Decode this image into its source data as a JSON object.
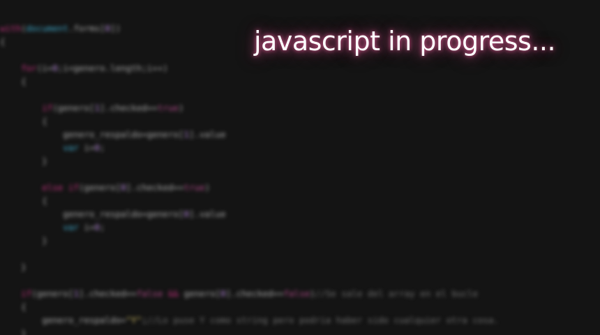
{
  "title": "javascript in progress...",
  "code_lines": [
    [
      {
        "t": "kw",
        "v": "with"
      },
      {
        "t": "txt",
        "v": "("
      },
      {
        "t": "obj",
        "v": "document"
      },
      {
        "t": "txt",
        "v": ".forms["
      },
      {
        "t": "num",
        "v": "0"
      },
      {
        "t": "txt",
        "v": "])"
      }
    ],
    [
      {
        "t": "txt",
        "v": "{"
      }
    ],
    [],
    [
      {
        "t": "txt",
        "v": "    "
      },
      {
        "t": "kw",
        "v": "for"
      },
      {
        "t": "txt",
        "v": "(i="
      },
      {
        "t": "num",
        "v": "0"
      },
      {
        "t": "txt",
        "v": ";i<genero.length;i++)"
      }
    ],
    [
      {
        "t": "txt",
        "v": "    {"
      }
    ],
    [],
    [
      {
        "t": "txt",
        "v": "        "
      },
      {
        "t": "kw",
        "v": "if"
      },
      {
        "t": "txt",
        "v": "(genero["
      },
      {
        "t": "num",
        "v": "1"
      },
      {
        "t": "txt",
        "v": "].checked=="
      },
      {
        "t": "lit",
        "v": "true"
      },
      {
        "t": "txt",
        "v": ")"
      }
    ],
    [
      {
        "t": "txt",
        "v": "        {"
      }
    ],
    [
      {
        "t": "txt",
        "v": "            genero_respaldo=genero["
      },
      {
        "t": "num",
        "v": "1"
      },
      {
        "t": "txt",
        "v": "].value"
      }
    ],
    [
      {
        "t": "txt",
        "v": "            "
      },
      {
        "t": "obj",
        "v": "var"
      },
      {
        "t": "txt",
        "v": " i="
      },
      {
        "t": "num",
        "v": "0"
      },
      {
        "t": "txt",
        "v": ";"
      }
    ],
    [
      {
        "t": "txt",
        "v": "        }"
      }
    ],
    [],
    [
      {
        "t": "txt",
        "v": "        "
      },
      {
        "t": "kw",
        "v": "else if"
      },
      {
        "t": "txt",
        "v": "(genero["
      },
      {
        "t": "num",
        "v": "0"
      },
      {
        "t": "txt",
        "v": "].checked=="
      },
      {
        "t": "lit",
        "v": "true"
      },
      {
        "t": "txt",
        "v": ")"
      }
    ],
    [
      {
        "t": "txt",
        "v": "        {"
      }
    ],
    [
      {
        "t": "txt",
        "v": "            genero_respaldo=genero["
      },
      {
        "t": "num",
        "v": "0"
      },
      {
        "t": "txt",
        "v": "].value"
      }
    ],
    [
      {
        "t": "txt",
        "v": "            "
      },
      {
        "t": "obj",
        "v": "var"
      },
      {
        "t": "txt",
        "v": " i="
      },
      {
        "t": "num",
        "v": "0"
      },
      {
        "t": "txt",
        "v": ";"
      }
    ],
    [
      {
        "t": "txt",
        "v": "        }"
      }
    ],
    [],
    [
      {
        "t": "txt",
        "v": "    }"
      }
    ],
    [],
    [
      {
        "t": "txt",
        "v": "    "
      },
      {
        "t": "kw",
        "v": "if"
      },
      {
        "t": "txt",
        "v": "(genero["
      },
      {
        "t": "num",
        "v": "1"
      },
      {
        "t": "txt",
        "v": "].checked=="
      },
      {
        "t": "lit",
        "v": "false"
      },
      {
        "t": "txt",
        "v": " "
      },
      {
        "t": "kw",
        "v": "&&"
      },
      {
        "t": "txt",
        "v": " genero["
      },
      {
        "t": "num",
        "v": "0"
      },
      {
        "t": "txt",
        "v": "].checked=="
      },
      {
        "t": "lit",
        "v": "false"
      },
      {
        "t": "txt",
        "v": ")"
      },
      {
        "t": "cmt",
        "v": "//Se sale del array en el bucle"
      }
    ],
    [
      {
        "t": "txt",
        "v": "    {"
      }
    ],
    [
      {
        "t": "txt",
        "v": "        genero_respaldo="
      },
      {
        "t": "str",
        "v": "\"Y\""
      },
      {
        "t": "txt",
        "v": ";"
      },
      {
        "t": "cmt",
        "v": "//Lo puse Y como string pero podria haber sido cualquier otra cosa."
      }
    ],
    [
      {
        "t": "txt",
        "v": "    }"
      }
    ]
  ]
}
